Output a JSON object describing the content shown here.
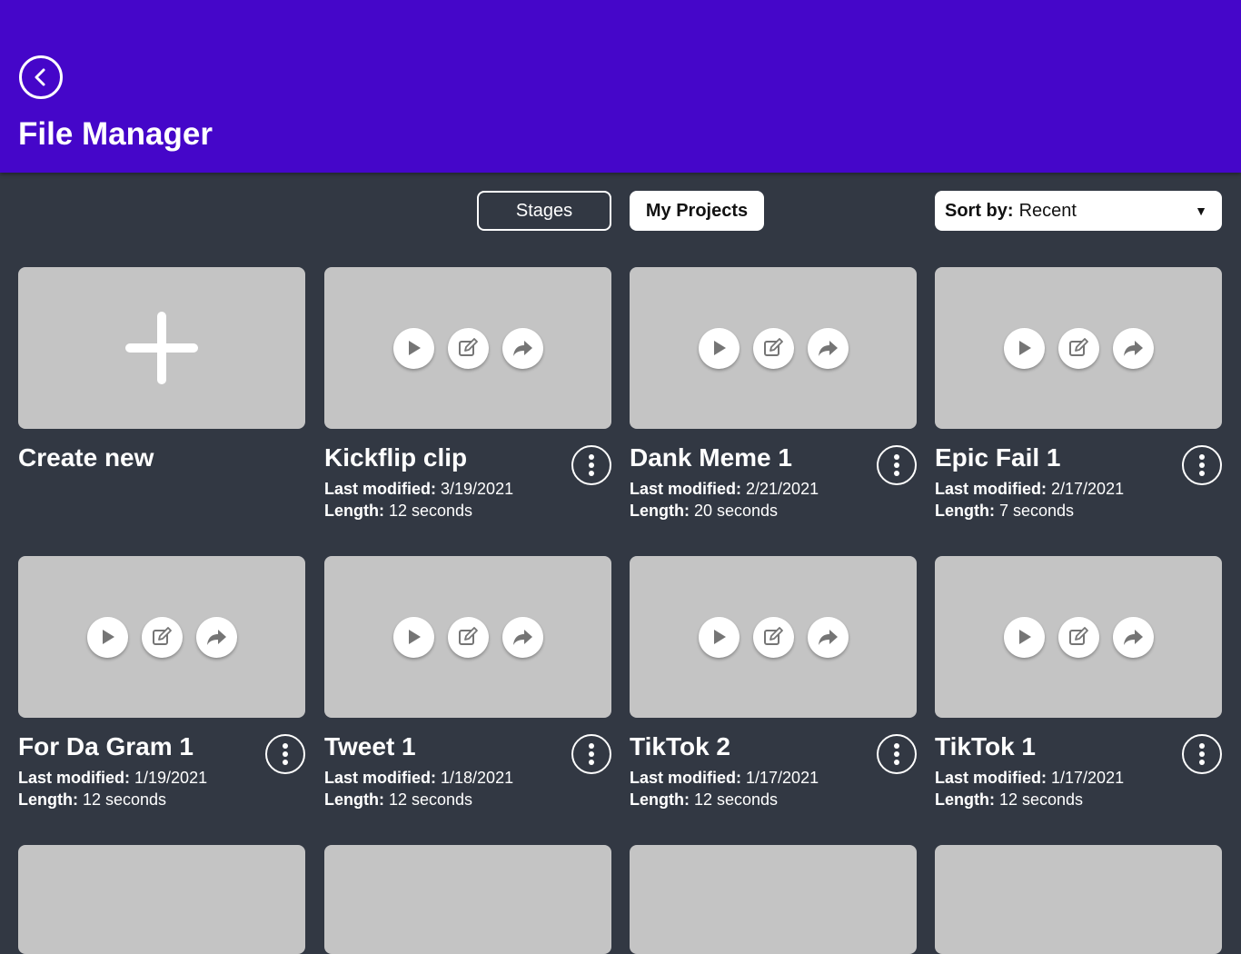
{
  "header": {
    "title": "File Manager",
    "back_icon": "back-arrow-icon",
    "bg_color": "#4506c9"
  },
  "tabs": [
    {
      "label": "Stages",
      "active": false
    },
    {
      "label": "My Projects",
      "active": true
    }
  ],
  "sort": {
    "label": "Sort by:",
    "value": "Recent"
  },
  "create": {
    "label": "Create new"
  },
  "labels": {
    "last_modified": "Last modified:",
    "length": "Length:"
  },
  "projects": [
    {
      "title": "Kickflip clip",
      "modified": "3/19/2021",
      "length": "12 seconds"
    },
    {
      "title": "Dank Meme 1",
      "modified": "2/21/2021",
      "length": "20 seconds"
    },
    {
      "title": "Epic Fail 1",
      "modified": "2/17/2021",
      "length": "7 seconds"
    },
    {
      "title": "For Da Gram 1",
      "modified": "1/19/2021",
      "length": "12 seconds"
    },
    {
      "title": "Tweet 1",
      "modified": "1/18/2021",
      "length": "12 seconds"
    },
    {
      "title": "TikTok 2",
      "modified": "1/17/2021",
      "length": "12 seconds"
    },
    {
      "title": "TikTok 1",
      "modified": "1/17/2021",
      "length": "12 seconds"
    }
  ]
}
